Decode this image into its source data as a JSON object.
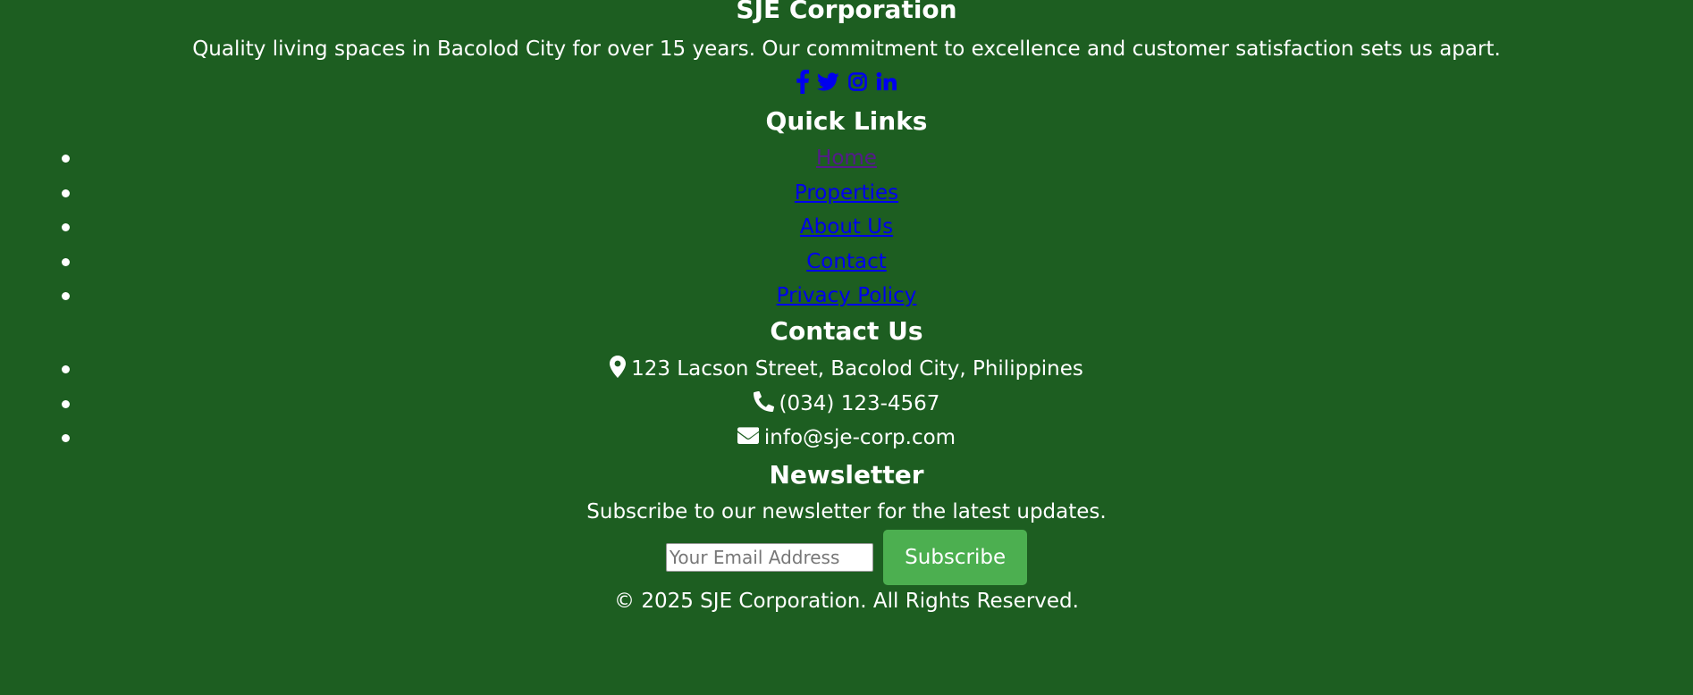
{
  "brand": {
    "name": "SJE Corporation",
    "tagline": "Quality living spaces in Bacolod City for over 15 years. Our commitment to excellence and customer satisfaction sets us apart."
  },
  "social": [
    {
      "icon": "facebook-icon"
    },
    {
      "icon": "twitter-icon"
    },
    {
      "icon": "instagram-icon"
    },
    {
      "icon": "linkedin-icon"
    }
  ],
  "quick_links": {
    "heading": "Quick Links",
    "items": [
      {
        "label": "Home"
      },
      {
        "label": "Properties"
      },
      {
        "label": "About Us"
      },
      {
        "label": "Contact"
      },
      {
        "label": "Privacy Policy"
      }
    ]
  },
  "contact": {
    "heading": "Contact Us",
    "items": [
      {
        "icon": "map-marker-icon",
        "text": "123 Lacson Street, Bacolod City, Philippines"
      },
      {
        "icon": "phone-icon",
        "text": "(034) 123-4567"
      },
      {
        "icon": "envelope-icon",
        "text": "info@sje-corp.com"
      }
    ]
  },
  "newsletter": {
    "heading": "Newsletter",
    "text": "Subscribe to our newsletter for the latest updates.",
    "email_placeholder": "Your Email Address",
    "email_value": "",
    "button_label": "Subscribe"
  },
  "copyright": "© 2025 SJE Corporation. All Rights Reserved.",
  "colors": {
    "background": "#1d5e21",
    "text": "#ffffff",
    "link": "#0000ee",
    "visited_link": "#551a8b",
    "button": "#4caf50"
  }
}
